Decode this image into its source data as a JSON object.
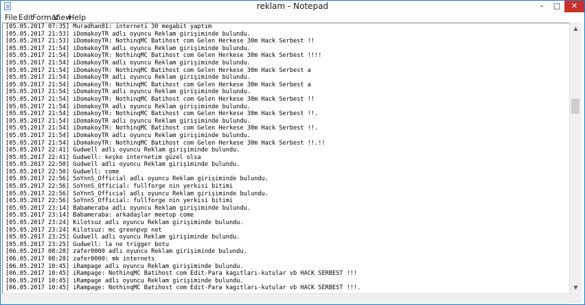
{
  "window": {
    "title": "reklam - Notepad"
  },
  "title_buttons": {
    "minimize": "–",
    "maximize": "□",
    "close": "✕"
  },
  "menu": [
    "File",
    "Edit",
    "Format",
    "View",
    "Help"
  ],
  "lines": [
    "[05.05.2017 07:35] Muradhan81: interneti 30 megabit yaptım",
    "[05.05.2017 21:53] iDomakoyTR adlı oyuncu Reklam girişiminde bulundu.",
    "[05.05.2017 21:53] iDomakoyTR: NothinqMC Batihost com Gelen Herkese 30m Hack Serbest !!",
    "[05.05.2017 21:54] iDomakoyTR adlı oyuncu Reklam girişiminde bulundu.",
    "[05.05.2017 21:54] iDomakoyTR: NothinqMC Batihost com Gelen Herkese 30m Hack Serbest !!!!",
    "[05.05.2017 21:54] iDomakoyTR adlı oyuncu Reklam girişiminde bulundu.",
    "[05.05.2017 21:54] iDomakoyTR: NothinqMC Batihost com Gelen Herkese 30m Hack Serbest a",
    "[05.05.2017 21:54] iDomakoyTR adlı oyuncu Reklam girişiminde bulundu.",
    "[05.05.2017 21:54] iDomakoyTR: NothinqMC Batihost com Gelen Herkese 30m Hack Serbest a",
    "[05.05.2017 21:54] iDomakoyTR adlı oyuncu Reklam girişiminde bulundu.",
    "[05.05.2017 21:54] iDomakoyTR: NothinqMC Batihost com Gelen Herkese 30m Hack Serbest !!",
    "[05.05.2017 21:54] iDomakoyTR adlı oyuncu Reklam girişiminde bulundu.",
    "[05.05.2017 21:54] iDomakoyTR: NothinqMC Batihost com Gelen Herkese 30m Hack Serbest !!.",
    "[05.05.2017 21:54] iDomakoyTR adlı oyuncu Reklam girişiminde bulundu.",
    "[05.05.2017 21:54] iDomakoyTR: NothinqMC Batihost com Gelen Herkese 30m Hack Serbest !!.",
    "[05.05.2017 21:54] iDomakoyTR adlı oyuncu Reklam girişiminde bulundu.",
    "[05.05.2017 21:54] iDomakoyTR: NothinqMC Batihost com Gelen Herkese 30m Hack Serbest !!.!!",
    "[05.05.2017 22:41] Gudwell adlı oyuncu Reklam girişiminde bulundu.",
    "[05.05.2017 22:41] Gudwell: keşke internetim güzel olsa",
    "[05.05.2017 22:50] Gudwell adlı oyuncu Reklam girişiminde bulundu.",
    "[05.05.2017 22:50] Gudwell: come",
    "[05.05.2017 22:56] SoYnnS_Official adlı oyuncu Reklam girişiminde bulundu.",
    "[05.05.2017 22:56] SoYnnS_Official: fullforge nin yerkisi bitimi",
    "[05.05.2017 22:56] SoYnnS_Official adlı oyuncu Reklam girişiminde bulundu.",
    "[05.05.2017 22:56] SoYnnS_Official: fullforge nin yerkisi bitimi",
    "[05.05.2017 23:14] Babameraba adlı oyuncu Reklam girişiminde bulundu.",
    "[05.05.2017 23:14] Babameraba: arkadaşlar meetup come",
    "[05.05.2017 23:24] Kilotsuz adlı oyuncu Reklam girişiminde bulundu.",
    "[05.05.2017 23:24] Kilotsuz: mc greenpvp net",
    "[05.05.2017 23:25] Gudwell adlı oyuncu Reklam girişiminde bulundu.",
    "[05.05.2017 23:25] Gudwell: la ne trigger botu",
    "[06.05.2017 08:28] zafer0000 adlı oyuncu Reklam girişiminde bulundu.",
    "[06.05.2017 08:28] zafer0000: mk internets",
    "[06.05.2017 10:45] iRampage adlı oyuncu Reklam girişiminde bulundu.",
    "[06.05.2017 10:45] iRampage: NothinqMC Batihost com Edit-Para kagıtları-kutular vb HACK SERBEST !!!",
    "[06.05.2017 10:45] iRampage adlı oyuncu Reklam girişiminde bulundu.",
    "[06.05.2017 10:45] iRampage: NothinqMC Batihost com Edit-Para kagıtları-kutular vb HACK SERBEST !!!."
  ],
  "scrollbar": {
    "up_arrow": "▲",
    "down_arrow": "▼"
  }
}
